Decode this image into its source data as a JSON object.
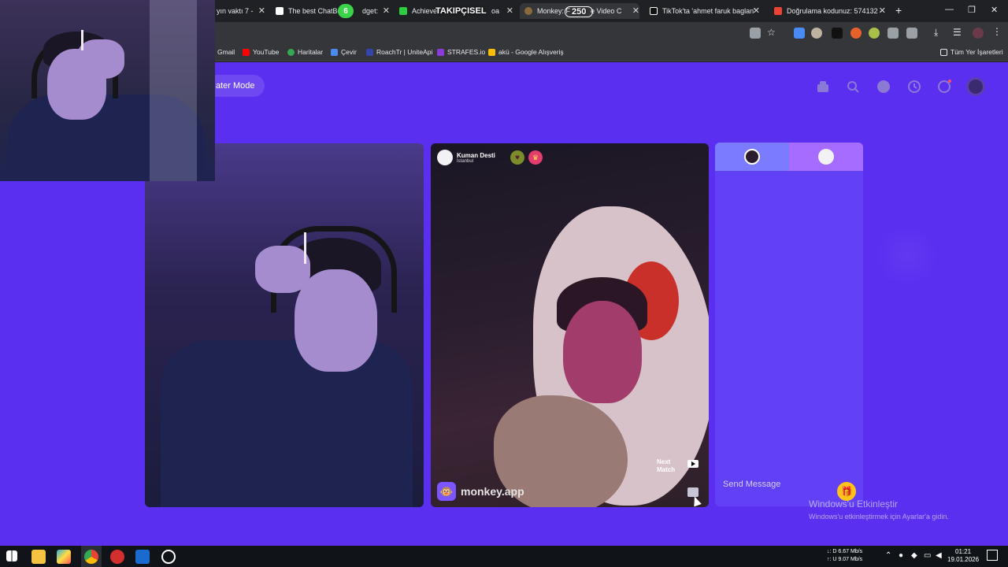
{
  "browser": {
    "tabs": [
      {
        "title": "yın vaktı 7 -",
        "active": false
      },
      {
        "title": "The best ChatBot",
        "suffix": "dget:",
        "active": false
      },
      {
        "title": "Achiever",
        "suffix": "oa",
        "active": false
      },
      {
        "title": "Monkey: F",
        "suffix": "e Video C",
        "active": true
      },
      {
        "title": "TikTok'ta 'ahmet faruk baglan'",
        "active": false
      },
      {
        "title": "Doğrulama kodunuz: 574132 -",
        "active": false
      }
    ],
    "new_tab": "+",
    "window_controls": {
      "minimize": "—",
      "maximize": "❐",
      "close": "✕"
    },
    "bookmarks": [
      "Gmail",
      "YouTube",
      "Haritalar",
      "Çevir",
      "RoachTr | UniteApi",
      "STRAFES.io",
      "akü - Google Alışveriş"
    ],
    "all_bookmarks": "Tüm Yer İşaretleri",
    "accent_colors": {
      "youtube": "#ff0000",
      "page_bg": "#5a2ff0"
    }
  },
  "stream_overlay": {
    "follower_label": "TAKIPÇISEL",
    "follower_count": "250",
    "badge_count": "6"
  },
  "page": {
    "theater_mode": "ater Mode",
    "top_icons": [
      "shop-icon",
      "search-icon",
      "friends-icon",
      "history-icon",
      "chat-icon",
      "profile-avatar-icon"
    ],
    "match": {
      "name": "Kuman Desti",
      "city": "İstanbul"
    },
    "next_match": "Next\nMatch",
    "brand": "monkey.app",
    "chat": {
      "send_placeholder": "Send Message"
    }
  },
  "windows_activation": {
    "title": "Windows'u Etkinleştir",
    "subtitle": "Windows'u etkinleştirmek için Ayarlar'a gidin."
  },
  "taskbar": {
    "net_down": "↓: D  6.67 Mb/s",
    "net_up": "↑: U  9.07 Mb/s",
    "time": "01:21",
    "date": "19.01.2026"
  }
}
